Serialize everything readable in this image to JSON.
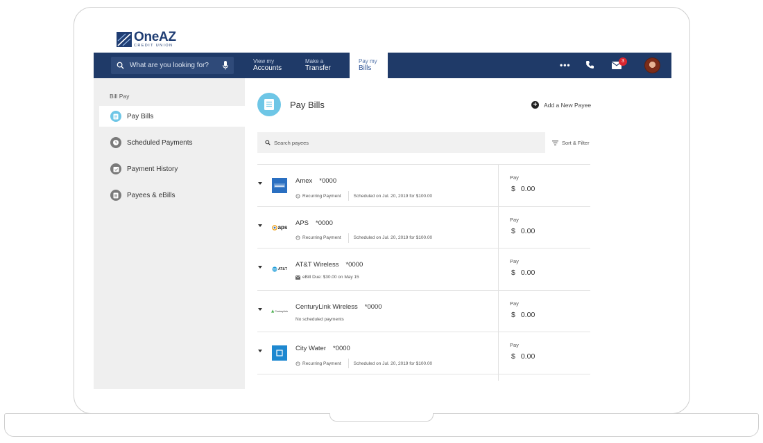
{
  "brand": {
    "name": "OneAZ",
    "sub": "CREDIT UNION",
    "color": "#1f3a68"
  },
  "topnav": {
    "search_placeholder": "What are you looking for?",
    "items": [
      {
        "small": "View my",
        "big": "Accounts"
      },
      {
        "small": "Make a",
        "big": "Transfer"
      },
      {
        "small": "Pay my",
        "big": "Bills",
        "active": true
      }
    ],
    "more": "•••",
    "mail_badge": "3"
  },
  "sidebar": {
    "heading": "Bill Pay",
    "items": [
      {
        "label": "Pay Bills",
        "icon": "bill-icon",
        "active": true
      },
      {
        "label": "Scheduled Payments",
        "icon": "clock-icon"
      },
      {
        "label": "Payment History",
        "icon": "history-icon"
      },
      {
        "label": "Payees & eBills",
        "icon": "list-icon"
      }
    ]
  },
  "main": {
    "title": "Pay Bills",
    "add_payee": "Add a New Payee",
    "search_placeholder": "Search payees",
    "sort_filter": "Sort & Filter"
  },
  "payees": [
    {
      "name": "Amex",
      "acct": "*0000",
      "logo": "amex-logo",
      "detail_icon": "recurring-icon",
      "detail": "Recurring Payment",
      "scheduled": "Scheduled on Jul. 20, 2019 for $100.00",
      "pay_label": "Pay",
      "currency": "$",
      "amount": "0.00"
    },
    {
      "name": "APS",
      "acct": "*0000",
      "logo": "aps-logo",
      "logo_text": "aps",
      "detail_icon": "recurring-icon",
      "detail": "Recurring Payment",
      "scheduled": "Scheduled on Jul. 20, 2019 for $100.00",
      "pay_label": "Pay",
      "currency": "$",
      "amount": "0.00"
    },
    {
      "name": "AT&T Wireless",
      "acct": "*0000",
      "logo": "att-logo",
      "logo_text": "AT&T",
      "detail_icon": "ebill-icon",
      "detail": "eBill Due: $30.00 on May 15",
      "scheduled": "",
      "pay_label": "Pay",
      "currency": "$",
      "amount": "0.00"
    },
    {
      "name": "CenturyLink Wireless",
      "acct": "*0000",
      "logo": "centurylink-logo",
      "logo_text": "CenturyLink",
      "detail_icon": "",
      "detail": "No scheduled payments",
      "scheduled": "",
      "pay_label": "Pay",
      "currency": "$",
      "amount": "0.00"
    },
    {
      "name": "City Water",
      "acct": "*0000",
      "logo": "city-water-logo",
      "detail_icon": "recurring-icon",
      "detail": "Recurring Payment",
      "scheduled": "Scheduled on Jul. 20, 2019 for $100.00",
      "pay_label": "Pay",
      "currency": "$",
      "amount": "0.00"
    }
  ]
}
